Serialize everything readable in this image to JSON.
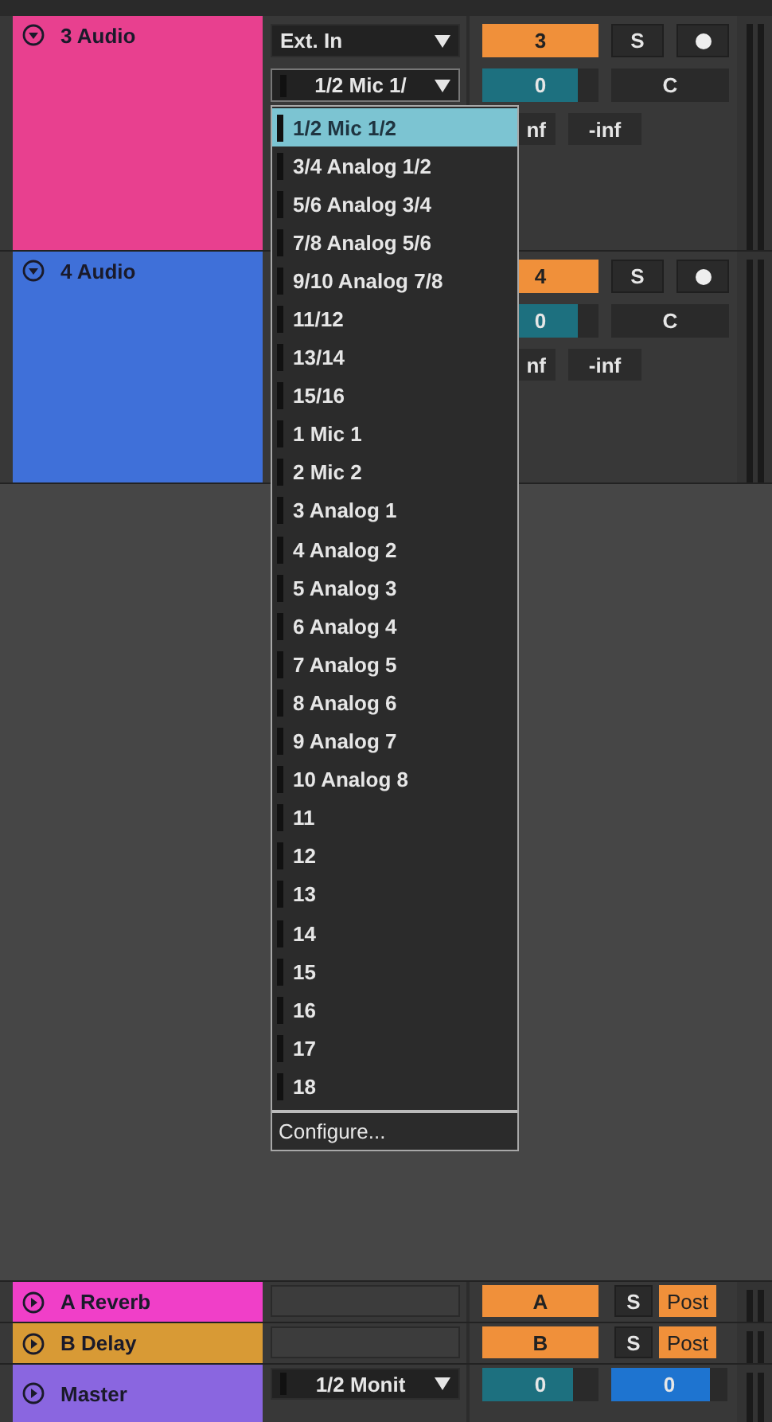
{
  "tracks": [
    {
      "name": "3 Audio",
      "color": "#e8408f",
      "expanded": true,
      "input_type": "Ext. In",
      "input_channel": "1/2 Mic 1/",
      "number": "3",
      "solo": "S",
      "armed": true,
      "volume": {
        "value": "0",
        "level": 0.82
      },
      "pan": "C",
      "peak_left": "nf",
      "peak_right": "-inf"
    },
    {
      "name": "4 Audio",
      "color": "#3f70d9",
      "expanded": true,
      "number": "4",
      "solo": "S",
      "armed": true,
      "volume": {
        "value": "0",
        "level": 0.82
      },
      "pan": "C",
      "peak_left": "nf",
      "peak_right": "-inf"
    }
  ],
  "input_menu": {
    "items": [
      {
        "label": "1/2 Mic 1/2",
        "selected": true
      },
      {
        "label": "3/4 Analog 1/2",
        "selected": false
      },
      {
        "label": "5/6 Analog 3/4",
        "selected": false
      },
      {
        "label": "7/8 Analog 5/6",
        "selected": false
      },
      {
        "label": "9/10 Analog 7/8",
        "selected": false
      },
      {
        "label": "11/12",
        "selected": false
      },
      {
        "label": "13/14",
        "selected": false
      },
      {
        "label": "15/16",
        "selected": false
      },
      {
        "label": "1 Mic 1",
        "selected": false
      },
      {
        "label": "2 Mic 2",
        "selected": false
      },
      {
        "label": "3 Analog 1",
        "selected": false
      },
      {
        "label": "4 Analog 2",
        "selected": false
      },
      {
        "label": "5 Analog 3",
        "selected": false
      },
      {
        "label": "6 Analog 4",
        "selected": false
      },
      {
        "label": "7 Analog 5",
        "selected": false
      },
      {
        "label": "8 Analog 6",
        "selected": false
      },
      {
        "label": "9 Analog 7",
        "selected": false
      },
      {
        "label": "10 Analog 8",
        "selected": false
      },
      {
        "label": "11",
        "selected": false
      },
      {
        "label": "12",
        "selected": false
      },
      {
        "label": "13",
        "selected": false
      },
      {
        "label": "14",
        "selected": false
      },
      {
        "label": "15",
        "selected": false
      },
      {
        "label": "16",
        "selected": false
      },
      {
        "label": "17",
        "selected": false
      },
      {
        "label": "18",
        "selected": false
      }
    ],
    "footer": "Configure..."
  },
  "returns": [
    {
      "kind": "return",
      "name": "A Reverb",
      "color": "#f03fc8",
      "expanded": false,
      "send": "A",
      "solo": "S",
      "mode": "Post"
    },
    {
      "kind": "return",
      "name": "B Delay",
      "color": "#d89a35",
      "expanded": false,
      "send": "B",
      "solo": "S",
      "mode": "Post"
    },
    {
      "kind": "master",
      "name": "Master",
      "color": "#8a66e0",
      "expanded": false,
      "output": "1/2 Monit",
      "volume": {
        "value": "0",
        "level": 0.78
      },
      "cue": {
        "value": "0",
        "level": 0.85
      }
    }
  ]
}
